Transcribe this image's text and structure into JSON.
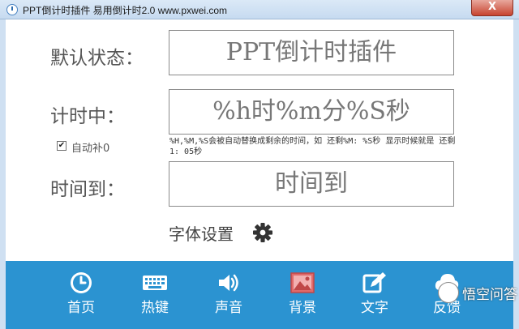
{
  "window": {
    "title": "PPT倒计时插件 易用倒计时2.0 www.pxwei.com",
    "close_label": "X"
  },
  "form": {
    "default_label": "默认状态：",
    "default_value": "PPT倒计时插件",
    "counting_label": "计时中：",
    "counting_value": "%h时%m分%S秒",
    "autofill_label": "自动补0",
    "autofill_checked": true,
    "hint": "%H,%M,%S会被自动替换成剩余的时间，如 还剩%M: %S秒 显示时候就是 还剩1: 05秒",
    "timeup_label": "时间到：",
    "timeup_value": "时间到",
    "font_settings_label": "字体设置"
  },
  "nav": {
    "items": [
      {
        "label": "首页",
        "icon": "clock-icon"
      },
      {
        "label": "热键",
        "icon": "keyboard-icon"
      },
      {
        "label": "声音",
        "icon": "speaker-icon"
      },
      {
        "label": "背景",
        "icon": "image-icon"
      },
      {
        "label": "文字",
        "icon": "edit-icon"
      },
      {
        "label": "反馈",
        "icon": "cloud-icon"
      }
    ]
  },
  "watermark": {
    "text": "悟空问答"
  },
  "colors": {
    "nav_bar": "#2b93d1",
    "title_bar": "#c6daf0",
    "close_button": "#c7432f",
    "active_icon": "#e06a6a"
  }
}
